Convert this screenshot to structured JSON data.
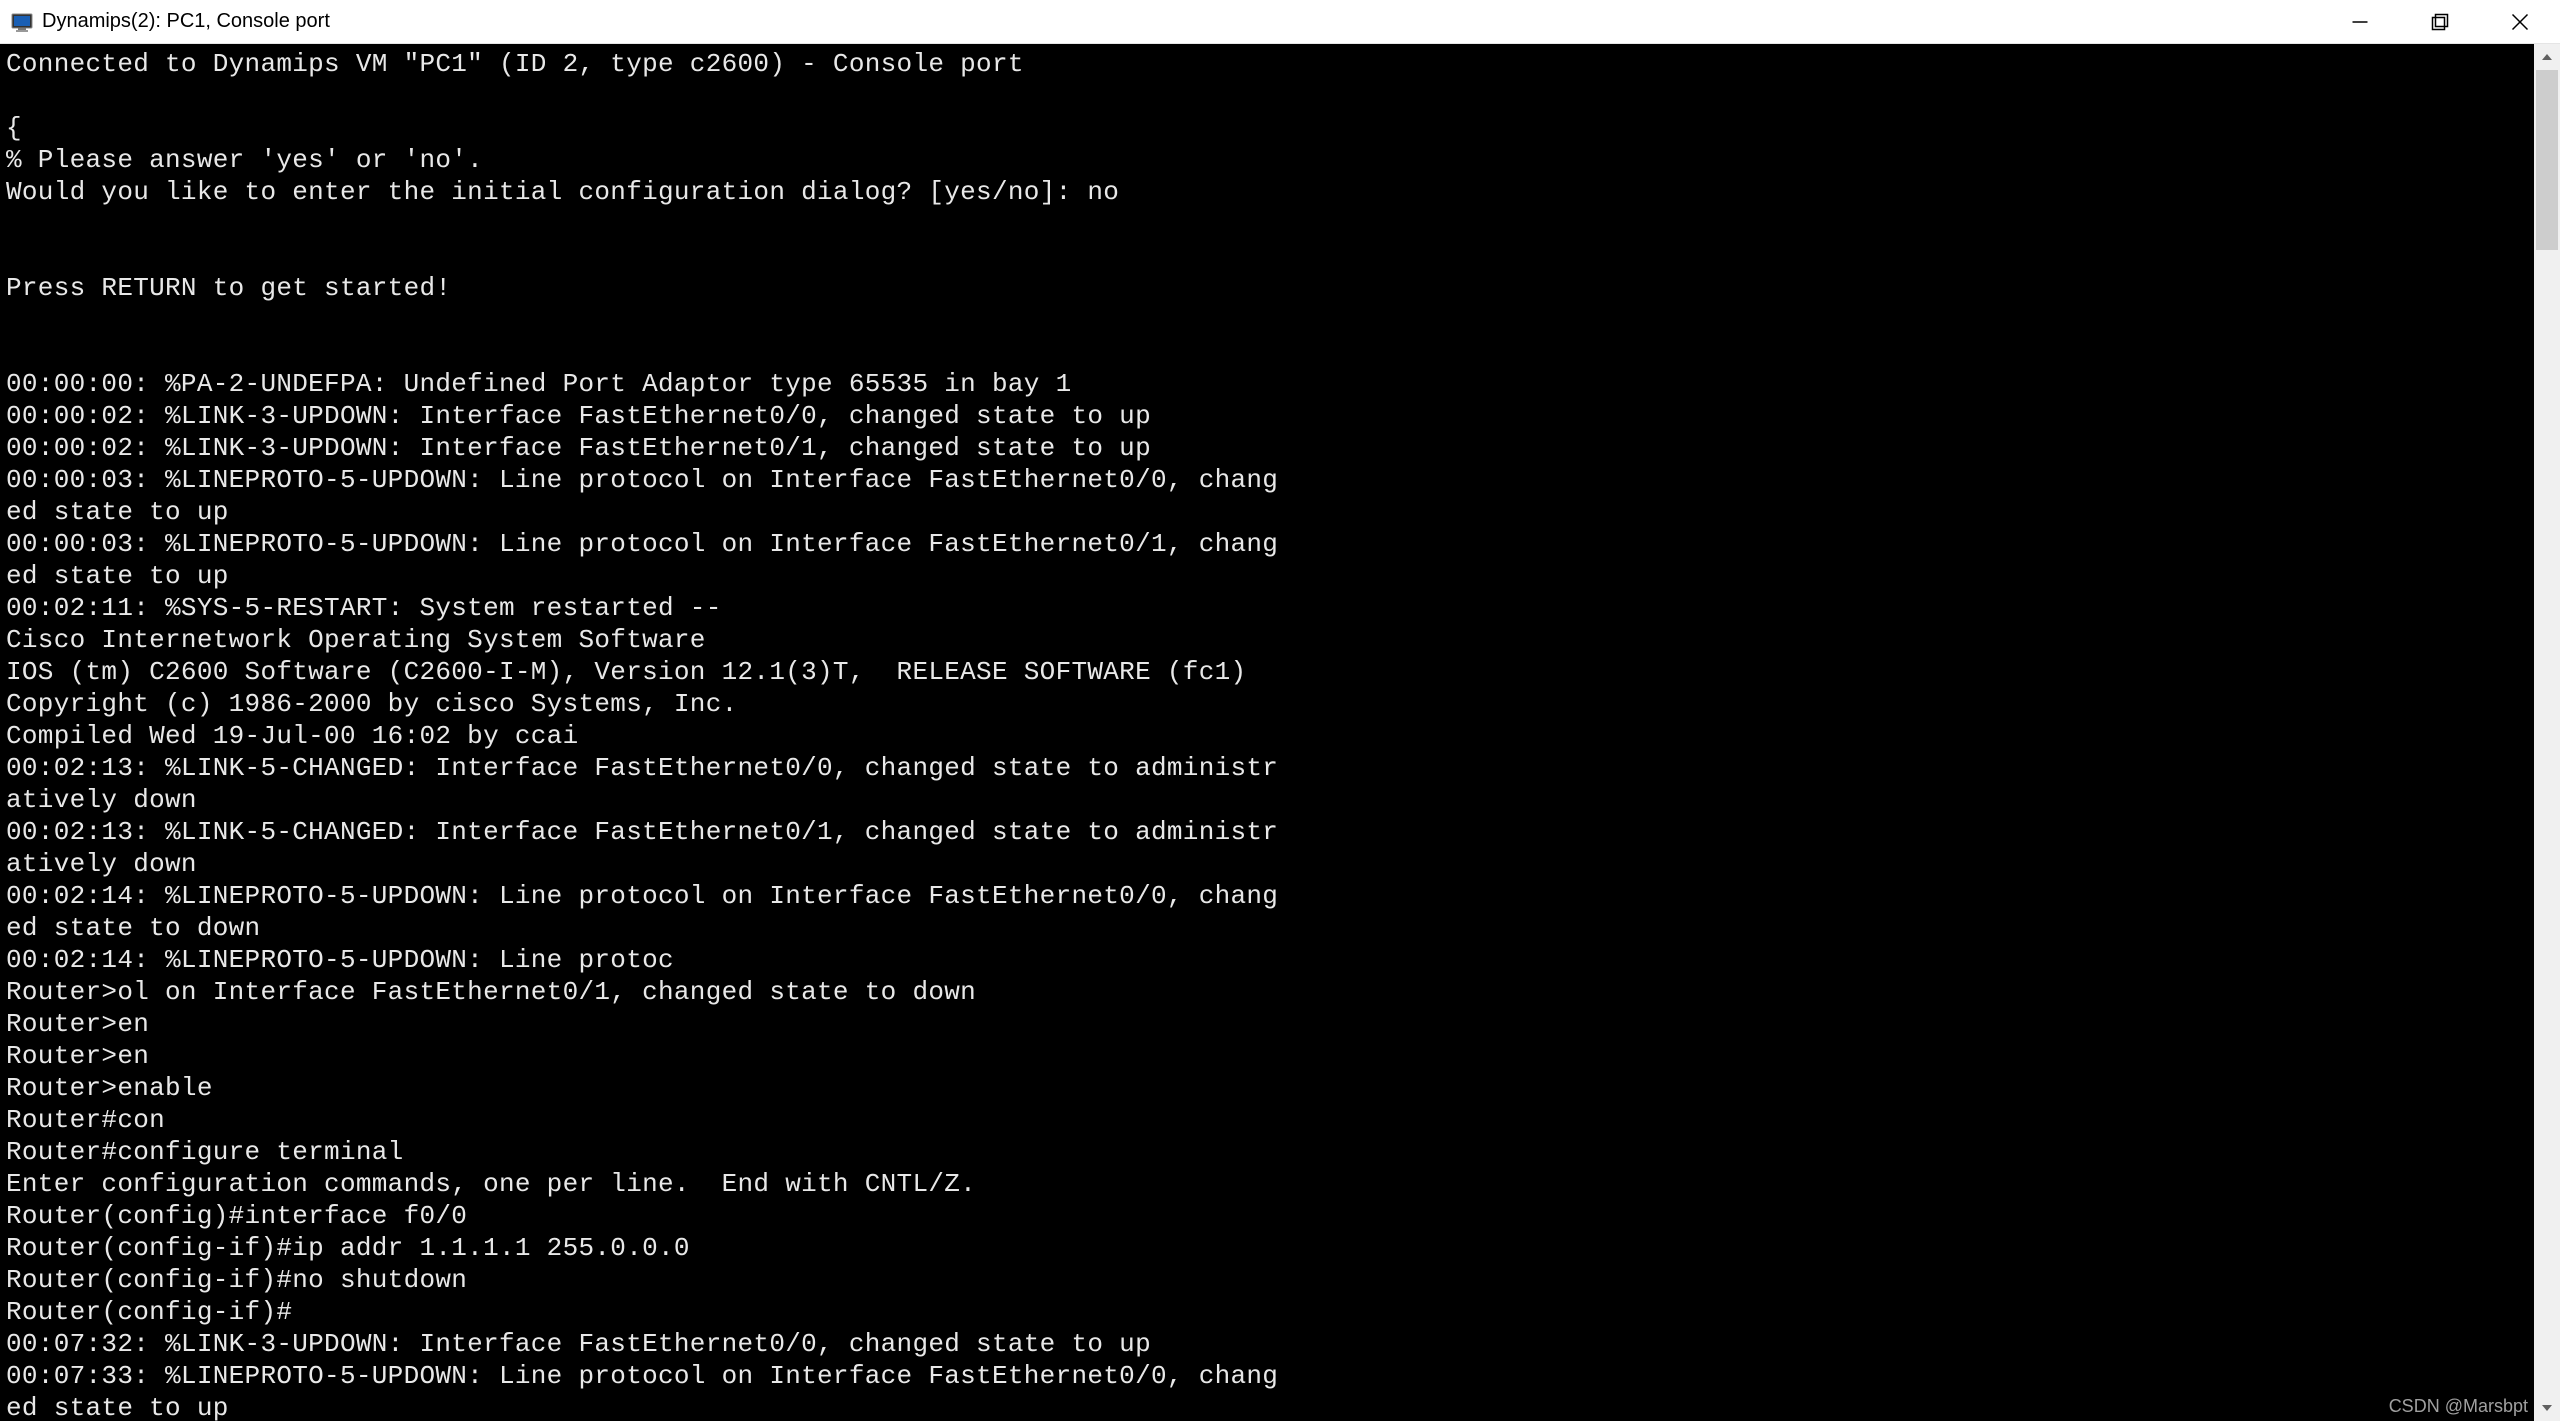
{
  "window": {
    "title": "Dynamips(2): PC1, Console port"
  },
  "terminal": {
    "lines": [
      "Connected to Dynamips VM \"PC1\" (ID 2, type c2600) - Console port",
      "",
      "{",
      "% Please answer 'yes' or 'no'.",
      "Would you like to enter the initial configuration dialog? [yes/no]: no",
      "",
      "",
      "Press RETURN to get started!",
      "",
      "",
      "00:00:00: %PA-2-UNDEFPA: Undefined Port Adaptor type 65535 in bay 1",
      "00:00:02: %LINK-3-UPDOWN: Interface FastEthernet0/0, changed state to up",
      "00:00:02: %LINK-3-UPDOWN: Interface FastEthernet0/1, changed state to up",
      "00:00:03: %LINEPROTO-5-UPDOWN: Line protocol on Interface FastEthernet0/0, chang",
      "ed state to up",
      "00:00:03: %LINEPROTO-5-UPDOWN: Line protocol on Interface FastEthernet0/1, chang",
      "ed state to up",
      "00:02:11: %SYS-5-RESTART: System restarted --",
      "Cisco Internetwork Operating System Software",
      "IOS (tm) C2600 Software (C2600-I-M), Version 12.1(3)T,  RELEASE SOFTWARE (fc1)",
      "Copyright (c) 1986-2000 by cisco Systems, Inc.",
      "Compiled Wed 19-Jul-00 16:02 by ccai",
      "00:02:13: %LINK-5-CHANGED: Interface FastEthernet0/0, changed state to administr",
      "atively down",
      "00:02:13: %LINK-5-CHANGED: Interface FastEthernet0/1, changed state to administr",
      "atively down",
      "00:02:14: %LINEPROTO-5-UPDOWN: Line protocol on Interface FastEthernet0/0, chang",
      "ed state to down",
      "00:02:14: %LINEPROTO-5-UPDOWN: Line protoc",
      "Router>ol on Interface FastEthernet0/1, changed state to down",
      "Router>en",
      "Router>en",
      "Router>enable",
      "Router#con",
      "Router#configure terminal",
      "Enter configuration commands, one per line.  End with CNTL/Z.",
      "Router(config)#interface f0/0",
      "Router(config-if)#ip addr 1.1.1.1 255.0.0.0",
      "Router(config-if)#no shutdown",
      "Router(config-if)#",
      "00:07:32: %LINK-3-UPDOWN: Interface FastEthernet0/0, changed state to up",
      "00:07:33: %LINEPROTO-5-UPDOWN: Line protocol on Interface FastEthernet0/0, chang",
      "ed state to up"
    ]
  },
  "watermark": "CSDN @Marsbpt"
}
